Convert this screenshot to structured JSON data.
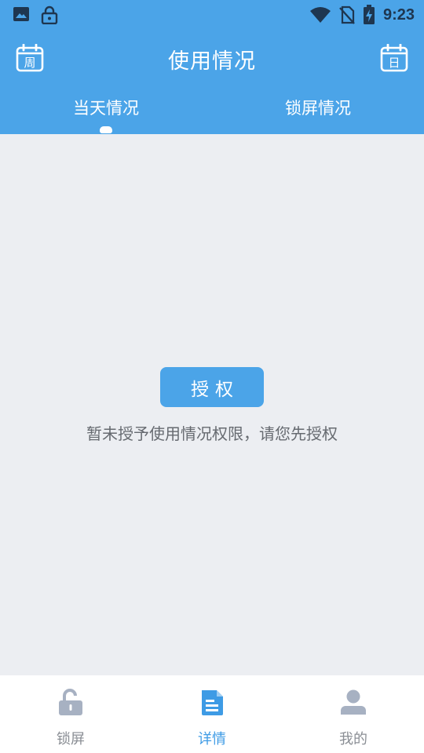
{
  "status_bar": {
    "time": "9:23",
    "left_icons": [
      "image-icon",
      "lock-icon"
    ],
    "right_icons": [
      "wifi-icon",
      "no-sim-icon",
      "battery-charging-icon"
    ]
  },
  "header": {
    "title": "使用情况",
    "left_icon": "calendar-week-icon",
    "left_icon_glyph": "周",
    "right_icon": "calendar-day-icon",
    "right_icon_glyph": "日"
  },
  "tabs": [
    {
      "label": "当天情况",
      "active": true
    },
    {
      "label": "锁屏情况",
      "active": false
    }
  ],
  "main": {
    "authorize_button": "授权",
    "hint": "暂未授予使用情况权限，请您先授权"
  },
  "bottom_nav": [
    {
      "label": "锁屏",
      "icon": "unlock-icon",
      "active": false
    },
    {
      "label": "详情",
      "icon": "document-icon",
      "active": true
    },
    {
      "label": "我的",
      "icon": "user-icon",
      "active": false
    }
  ],
  "colors": {
    "primary": "#4BA4E8",
    "background": "#ECEEF2",
    "active_nav": "#3E9BE5",
    "inactive_nav": "#A7B1C2"
  }
}
